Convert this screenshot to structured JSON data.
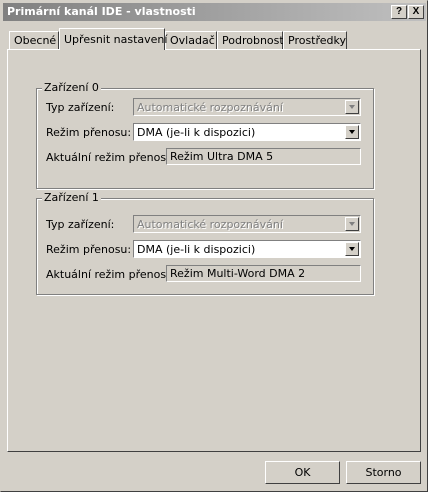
{
  "window": {
    "title": "Primární kanál IDE - vlastnosti",
    "help_button": "?",
    "close_button": "X"
  },
  "tabs": [
    {
      "label": "Obecné",
      "active": false
    },
    {
      "label": "Upřesnit nastavení",
      "active": true
    },
    {
      "label": "Ovladač",
      "active": false
    },
    {
      "label": "Podrobnosti",
      "active": false
    },
    {
      "label": "Prostředky",
      "active": false
    }
  ],
  "devices": [
    {
      "legend": "Zařízení 0",
      "type_label": "Typ zařízení:",
      "type_value": "Automatické rozpoznávání",
      "mode_label": "Režim přenosu:",
      "mode_value": "DMA (je-li k dispozici)",
      "current_label": "Aktuální režim přenosu:",
      "current_value": "Režim Ultra DMA 5"
    },
    {
      "legend": "Zařízení 1",
      "type_label": "Typ zařízení:",
      "type_value": "Automatické rozpoznávání",
      "mode_label": "Režim přenosu:",
      "mode_value": "DMA (je-li k dispozici)",
      "current_label": "Aktuální režim přenosu:",
      "current_value": "Režim Multi-Word DMA 2"
    }
  ],
  "buttons": {
    "ok": "OK",
    "cancel": "Storno"
  }
}
